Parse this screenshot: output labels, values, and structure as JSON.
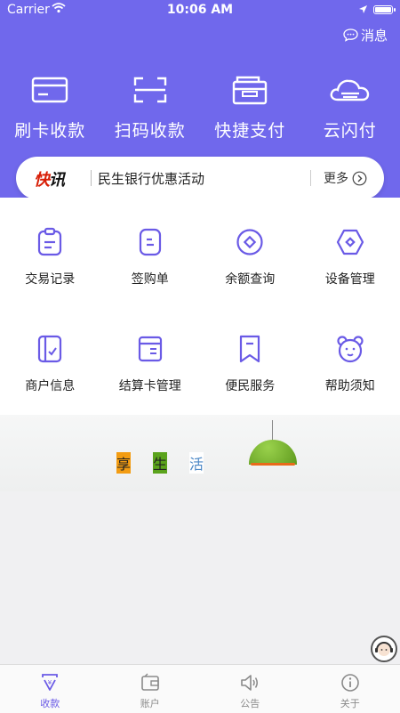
{
  "status": {
    "carrier": "Carrier",
    "time": "10:06 AM"
  },
  "header": {
    "message_label": "消息",
    "actions": [
      {
        "label": "刷卡收款",
        "icon": "card-icon"
      },
      {
        "label": "扫码收款",
        "icon": "scan-icon"
      },
      {
        "label": "快捷支付",
        "icon": "wallet-icon"
      },
      {
        "label": "云闪付",
        "icon": "cloud-icon"
      }
    ]
  },
  "news": {
    "tag_a": "快",
    "tag_b": "讯",
    "text": "民生银行优惠活动",
    "more": "更多"
  },
  "grid": [
    {
      "label": "交易记录",
      "icon": "clipboard-icon"
    },
    {
      "label": "签购单",
      "icon": "receipt-icon"
    },
    {
      "label": "余额查询",
      "icon": "balance-icon"
    },
    {
      "label": "设备管理",
      "icon": "hexagon-icon"
    },
    {
      "label": "商户信息",
      "icon": "merchant-icon"
    },
    {
      "label": "结算卡管理",
      "icon": "settlement-card-icon"
    },
    {
      "label": "便民服务",
      "icon": "bookmark-icon"
    },
    {
      "label": "帮助须知",
      "icon": "bear-icon"
    }
  ],
  "banner": {
    "chars": [
      "享",
      "生",
      "活"
    ],
    "colors": [
      "#f39c12",
      "#5ba31c",
      "#ffffff"
    ]
  },
  "tabbar": [
    {
      "label": "收款",
      "icon": "receive-icon",
      "active": true
    },
    {
      "label": "账户",
      "icon": "account-icon",
      "active": false
    },
    {
      "label": "公告",
      "icon": "speaker-icon",
      "active": false
    },
    {
      "label": "关于",
      "icon": "info-icon",
      "active": false
    }
  ],
  "colors": {
    "primary": "#7068ec",
    "accent": "#6a5ae6"
  }
}
